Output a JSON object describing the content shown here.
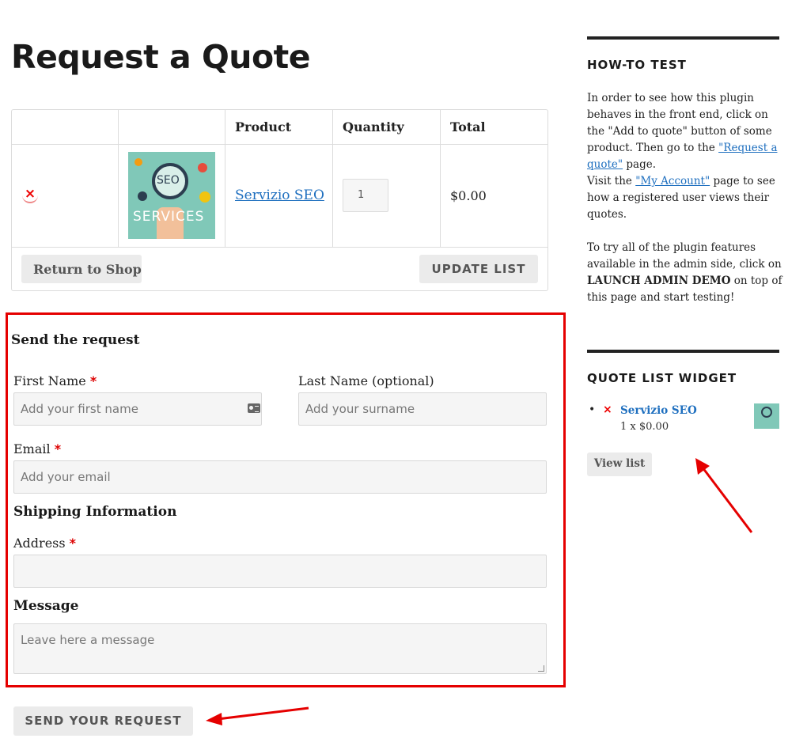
{
  "page": {
    "title": "Request a Quote"
  },
  "table": {
    "headers": [
      "",
      "",
      "Product",
      "Quantity",
      "Total"
    ],
    "row": {
      "remove": "×",
      "thumb_text_1": "SEO",
      "thumb_text_2": "SERVICES",
      "product": "Servizio SEO",
      "quantity": "1",
      "total": "$0.00"
    },
    "return_label": "Return to Shop",
    "update_label": "UPDATE LIST"
  },
  "form": {
    "title": "Send the request",
    "first_name": {
      "label": "First Name",
      "req": "*",
      "placeholder": "Add your first name"
    },
    "last_name": {
      "label": "Last Name (optional)",
      "placeholder": "Add your surname"
    },
    "email": {
      "label": "Email",
      "req": "*",
      "placeholder": "Add your email"
    },
    "shipping_title": "Shipping Information",
    "address": {
      "label": "Address",
      "req": "*",
      "placeholder": ""
    },
    "message": {
      "label": "Message",
      "placeholder": "Leave here a message"
    },
    "send_label": "SEND YOUR REQUEST"
  },
  "sidebar": {
    "howto": {
      "title": "HOW-TO TEST",
      "p1_a": "In order to see how this plugin behaves in the front end, click on the \"Add to quote\" button of some product. Then go to the ",
      "p1_link": "\"Request a quote\"",
      "p1_b": " page.",
      "p2_a": "Visit the ",
      "p2_link": "\"My Account\"",
      "p2_b": " page to see how a registered user views their quotes.",
      "p3_a": "To try all of the plugin features available in the admin side, click on ",
      "p3_bold": "LAUNCH ADMIN DEMO",
      "p3_b": " on top of this page and start testing!"
    },
    "widget": {
      "title": "QUOTE LIST WIDGET",
      "bullet": "•",
      "remove": "×",
      "item": "Servizio SEO",
      "price": "1 x $0.00",
      "view_label": "View list"
    }
  },
  "colors": {
    "accent_red": "#e50000",
    "link": "#1e6fbf",
    "button_bg": "#ebebeb"
  }
}
